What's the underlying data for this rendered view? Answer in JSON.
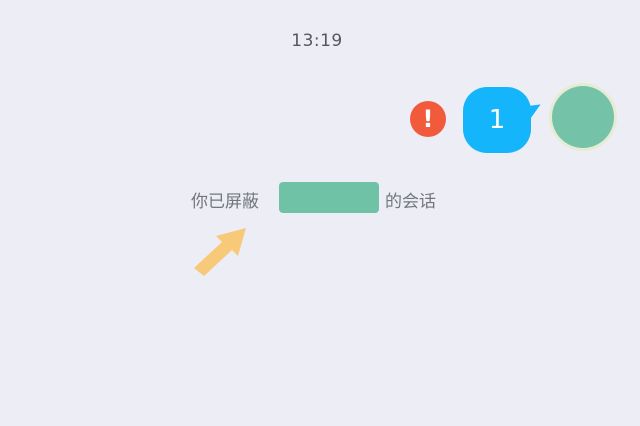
{
  "status": {
    "time": "13:19"
  },
  "conversation": {
    "outgoing_message": {
      "text": "1",
      "send_failed_badge": "!"
    },
    "system_notice": {
      "prefix": "你已屏蔽",
      "suffix": "的会话"
    }
  },
  "colors": {
    "background": "#ecedf5",
    "bubble": "#14b5fa",
    "error_badge": "#f25a3c",
    "redaction": "#70c2a6",
    "arrow": "#f7c978"
  },
  "icons": {
    "failed": "exclamation-circle-icon",
    "pointer": "arrow-icon"
  }
}
